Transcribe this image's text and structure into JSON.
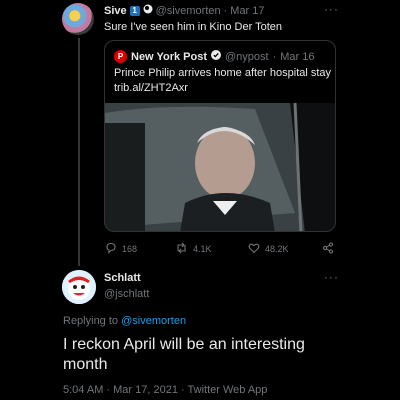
{
  "parent_tweet": {
    "display_name": "Sive",
    "name_badge": "1",
    "handle": "@sivemorten",
    "separator": "·",
    "date": "Mar 17",
    "text": "Sure I've seen him in Kino Der Toten",
    "more_menu": "···"
  },
  "quoted_tweet": {
    "display_name": "New York Post",
    "logo_letter": "P",
    "handle": "@nypost",
    "separator": "·",
    "date": "Mar 16",
    "text": "Prince Philip arrives home after hospital stay",
    "link": "trib.al/ZHT2Axr"
  },
  "actions": {
    "replies": "168",
    "retweets": "4.1K",
    "likes": "48.2K"
  },
  "reply_tweet": {
    "display_name": "Schlatt",
    "handle": "@jschlatt",
    "more_menu": "···",
    "replying_prefix": "Replying to",
    "replying_to": "@sivemorten",
    "text": "I reckon April will be an interesting month",
    "timestamp": "5:04 AM · Mar 17, 2021 · Twitter Web App"
  },
  "colors": {
    "background": "#000000",
    "text": "#e7e9ea",
    "muted": "#71767b",
    "link": "#1d9bf0",
    "border": "#2f3336"
  }
}
